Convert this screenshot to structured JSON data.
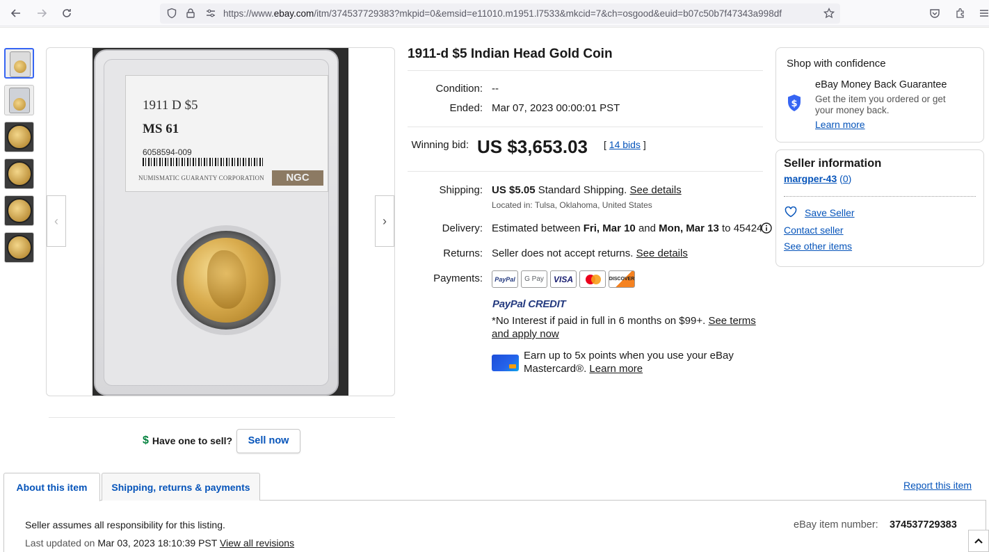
{
  "browser": {
    "url_prefix": "https://www.",
    "url_domain": "ebay.com",
    "url_rest": "/itm/374537729383?mkpid=0&emsid=e11010.m1951.l7533&mkcid=7&ch=osgood&euid=b07c50b7f47343a998df"
  },
  "gallery": {
    "slab_label_line1": "1911 D $5",
    "slab_label_line2": "MS 61",
    "slab_cert": "6058594-009",
    "slab_corp": "NUMISMATIC GUARANTY CORPORATION",
    "slab_brand": "NGC"
  },
  "sell": {
    "question": "Have one to sell?",
    "button": "Sell now"
  },
  "item": {
    "title": "1911-d $5 Indian Head Gold Coin",
    "condition_label": "Condition:",
    "condition_value": "--",
    "ended_label": "Ended:",
    "ended_value": "Mar 07, 2023 00:00:01 PST",
    "winning_bid_label": "Winning bid:",
    "winning_bid_value": "US $3,653.03",
    "bids_link": "14 bids",
    "shipping_label": "Shipping:",
    "shipping_price": "US $5.05",
    "shipping_method": "Standard Shipping.",
    "shipping_details_link": "See details",
    "located_in": "Located in: Tulsa, Oklahoma, United States",
    "delivery_label": "Delivery:",
    "delivery_prefix": "Estimated between",
    "delivery_start": "Fri, Mar 10",
    "delivery_and": "and",
    "delivery_end": "Mon, Mar 13",
    "delivery_to": "to 45424",
    "returns_label": "Returns:",
    "returns_value": "Seller does not accept returns.",
    "returns_link": "See details",
    "payments_label": "Payments:",
    "payment_logos": [
      "PayPal",
      "G Pay",
      "VISA",
      "Mastercard",
      "DISCOVER"
    ],
    "paypal_credit_a": "PayPal",
    "paypal_credit_b": "CREDIT",
    "paypal_credit_text": "*No Interest if paid in full in 6 months on $99+.",
    "paypal_credit_link_1": "See terms",
    "paypal_credit_link_2": "and apply now",
    "mastercard_text_1": "Earn up to 5x points when you use your eBay",
    "mastercard_text_2": "Mastercard®.",
    "mastercard_link": "Learn more"
  },
  "confidence": {
    "heading": "Shop with confidence",
    "guarantee_title": "eBay Money Back Guarantee",
    "guarantee_text_1": "Get the item you ordered or get",
    "guarantee_text_2": "your money back.",
    "learn_more": "Learn more"
  },
  "seller": {
    "heading": "Seller information",
    "name": "margper-43",
    "feedback_open": "(",
    "feedback": "0",
    "feedback_close": ")",
    "save": "Save Seller",
    "contact": "Contact seller",
    "other_items": "See other items"
  },
  "tabs": {
    "about": "About this item",
    "shipping": "Shipping, returns & payments",
    "report": "Report this item"
  },
  "about": {
    "responsibility": "Seller assumes all responsibility for this listing.",
    "last_updated": "Last updated on",
    "last_updated_value": "Mar 03, 2023 18:10:39 PST",
    "revisions_link": "View all revisions",
    "item_number_label": "eBay item number:",
    "item_number": "374537729383"
  }
}
